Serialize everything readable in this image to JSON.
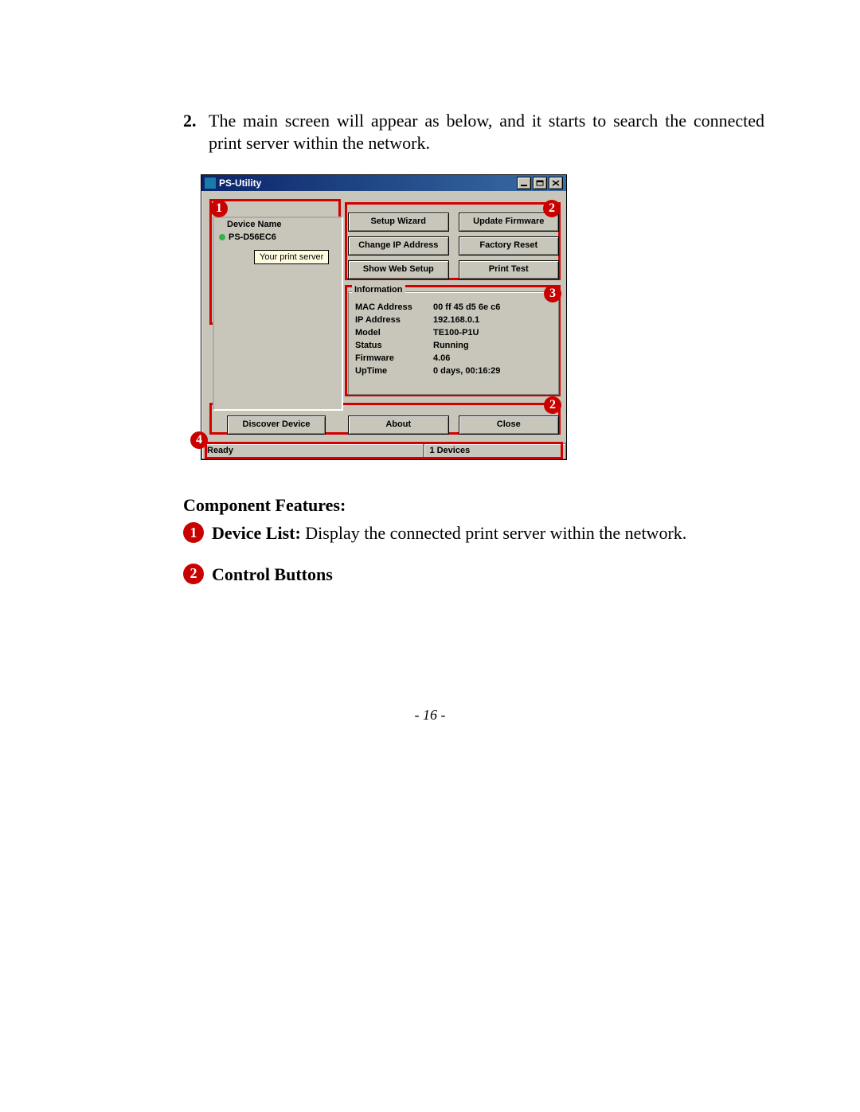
{
  "ol": {
    "num": "2.",
    "text": "The main screen will appear as below, and it starts to search the connected print server within the network."
  },
  "win": {
    "title": "PS-Utility",
    "deviceListHeader": "Device Name",
    "deviceName": "PS-D56EC6",
    "tooltip": "Your print server",
    "buttons": {
      "setupWizard": "Setup Wizard",
      "updateFirmware": "Update Firmware",
      "changeIp": "Change IP Address",
      "factoryReset": "Factory Reset",
      "showWebSetup": "Show Web Setup",
      "printTest": "Print Test",
      "discover": "Discover Device",
      "about": "About",
      "close": "Close"
    },
    "infoLegend": "Information",
    "info": {
      "macK": "MAC Address",
      "macV": "00 ff 45 d5 6e c6",
      "ipK": "IP Address",
      "ipV": "192.168.0.1",
      "modK": "Model",
      "modV": "TE100-P1U",
      "staK": "Status",
      "staV": "Running",
      "fwK": "Firmware",
      "fwV": "4.06",
      "utK": "UpTime",
      "utV": "0 days, 00:16:29"
    },
    "status": {
      "left": "Ready",
      "right": "1 Devices"
    },
    "callouts": {
      "c1": "1",
      "c2": "2",
      "c2b": "2",
      "c3": "3",
      "c4": "4"
    }
  },
  "cf": {
    "heading": "Component Features:",
    "item1": {
      "num": "1",
      "title": "Device List:",
      "body": "Display the connected print server within the network."
    },
    "item2": {
      "num": "2",
      "title": "Control Buttons",
      "body": ""
    }
  },
  "pageNum": "- 16 -"
}
